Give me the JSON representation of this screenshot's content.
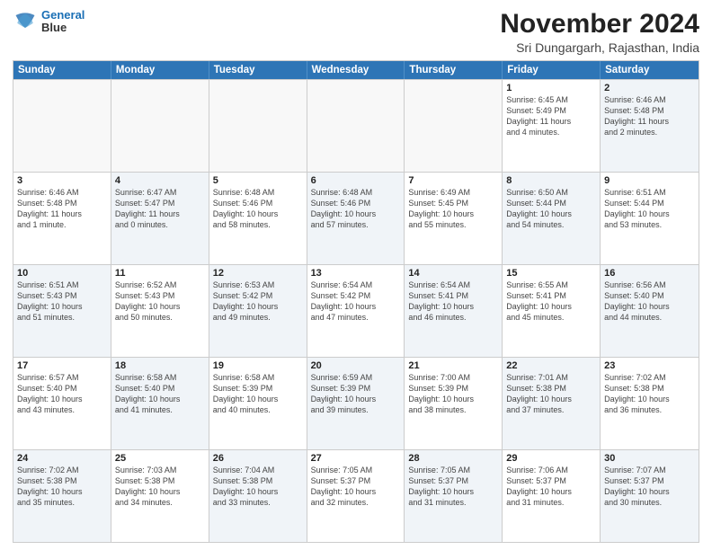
{
  "logo": {
    "line1": "General",
    "line2": "Blue"
  },
  "title": "November 2024",
  "subtitle": "Sri Dungargarh, Rajasthan, India",
  "header_days": [
    "Sunday",
    "Monday",
    "Tuesday",
    "Wednesday",
    "Thursday",
    "Friday",
    "Saturday"
  ],
  "weeks": [
    [
      {
        "day": "",
        "info": "",
        "empty": true
      },
      {
        "day": "",
        "info": "",
        "empty": true
      },
      {
        "day": "",
        "info": "",
        "empty": true
      },
      {
        "day": "",
        "info": "",
        "empty": true
      },
      {
        "day": "",
        "info": "",
        "empty": true
      },
      {
        "day": "1",
        "info": "Sunrise: 6:45 AM\nSunset: 5:49 PM\nDaylight: 11 hours\nand 4 minutes.",
        "empty": false
      },
      {
        "day": "2",
        "info": "Sunrise: 6:46 AM\nSunset: 5:48 PM\nDaylight: 11 hours\nand 2 minutes.",
        "empty": false,
        "shaded": true
      }
    ],
    [
      {
        "day": "3",
        "info": "Sunrise: 6:46 AM\nSunset: 5:48 PM\nDaylight: 11 hours\nand 1 minute.",
        "empty": false
      },
      {
        "day": "4",
        "info": "Sunrise: 6:47 AM\nSunset: 5:47 PM\nDaylight: 11 hours\nand 0 minutes.",
        "empty": false,
        "shaded": true
      },
      {
        "day": "5",
        "info": "Sunrise: 6:48 AM\nSunset: 5:46 PM\nDaylight: 10 hours\nand 58 minutes.",
        "empty": false
      },
      {
        "day": "6",
        "info": "Sunrise: 6:48 AM\nSunset: 5:46 PM\nDaylight: 10 hours\nand 57 minutes.",
        "empty": false,
        "shaded": true
      },
      {
        "day": "7",
        "info": "Sunrise: 6:49 AM\nSunset: 5:45 PM\nDaylight: 10 hours\nand 55 minutes.",
        "empty": false
      },
      {
        "day": "8",
        "info": "Sunrise: 6:50 AM\nSunset: 5:44 PM\nDaylight: 10 hours\nand 54 minutes.",
        "empty": false,
        "shaded": true
      },
      {
        "day": "9",
        "info": "Sunrise: 6:51 AM\nSunset: 5:44 PM\nDaylight: 10 hours\nand 53 minutes.",
        "empty": false
      }
    ],
    [
      {
        "day": "10",
        "info": "Sunrise: 6:51 AM\nSunset: 5:43 PM\nDaylight: 10 hours\nand 51 minutes.",
        "empty": false,
        "shaded": true
      },
      {
        "day": "11",
        "info": "Sunrise: 6:52 AM\nSunset: 5:43 PM\nDaylight: 10 hours\nand 50 minutes.",
        "empty": false
      },
      {
        "day": "12",
        "info": "Sunrise: 6:53 AM\nSunset: 5:42 PM\nDaylight: 10 hours\nand 49 minutes.",
        "empty": false,
        "shaded": true
      },
      {
        "day": "13",
        "info": "Sunrise: 6:54 AM\nSunset: 5:42 PM\nDaylight: 10 hours\nand 47 minutes.",
        "empty": false
      },
      {
        "day": "14",
        "info": "Sunrise: 6:54 AM\nSunset: 5:41 PM\nDaylight: 10 hours\nand 46 minutes.",
        "empty": false,
        "shaded": true
      },
      {
        "day": "15",
        "info": "Sunrise: 6:55 AM\nSunset: 5:41 PM\nDaylight: 10 hours\nand 45 minutes.",
        "empty": false
      },
      {
        "day": "16",
        "info": "Sunrise: 6:56 AM\nSunset: 5:40 PM\nDaylight: 10 hours\nand 44 minutes.",
        "empty": false,
        "shaded": true
      }
    ],
    [
      {
        "day": "17",
        "info": "Sunrise: 6:57 AM\nSunset: 5:40 PM\nDaylight: 10 hours\nand 43 minutes.",
        "empty": false
      },
      {
        "day": "18",
        "info": "Sunrise: 6:58 AM\nSunset: 5:40 PM\nDaylight: 10 hours\nand 41 minutes.",
        "empty": false,
        "shaded": true
      },
      {
        "day": "19",
        "info": "Sunrise: 6:58 AM\nSunset: 5:39 PM\nDaylight: 10 hours\nand 40 minutes.",
        "empty": false
      },
      {
        "day": "20",
        "info": "Sunrise: 6:59 AM\nSunset: 5:39 PM\nDaylight: 10 hours\nand 39 minutes.",
        "empty": false,
        "shaded": true
      },
      {
        "day": "21",
        "info": "Sunrise: 7:00 AM\nSunset: 5:39 PM\nDaylight: 10 hours\nand 38 minutes.",
        "empty": false
      },
      {
        "day": "22",
        "info": "Sunrise: 7:01 AM\nSunset: 5:38 PM\nDaylight: 10 hours\nand 37 minutes.",
        "empty": false,
        "shaded": true
      },
      {
        "day": "23",
        "info": "Sunrise: 7:02 AM\nSunset: 5:38 PM\nDaylight: 10 hours\nand 36 minutes.",
        "empty": false
      }
    ],
    [
      {
        "day": "24",
        "info": "Sunrise: 7:02 AM\nSunset: 5:38 PM\nDaylight: 10 hours\nand 35 minutes.",
        "empty": false,
        "shaded": true
      },
      {
        "day": "25",
        "info": "Sunrise: 7:03 AM\nSunset: 5:38 PM\nDaylight: 10 hours\nand 34 minutes.",
        "empty": false
      },
      {
        "day": "26",
        "info": "Sunrise: 7:04 AM\nSunset: 5:38 PM\nDaylight: 10 hours\nand 33 minutes.",
        "empty": false,
        "shaded": true
      },
      {
        "day": "27",
        "info": "Sunrise: 7:05 AM\nSunset: 5:37 PM\nDaylight: 10 hours\nand 32 minutes.",
        "empty": false
      },
      {
        "day": "28",
        "info": "Sunrise: 7:05 AM\nSunset: 5:37 PM\nDaylight: 10 hours\nand 31 minutes.",
        "empty": false,
        "shaded": true
      },
      {
        "day": "29",
        "info": "Sunrise: 7:06 AM\nSunset: 5:37 PM\nDaylight: 10 hours\nand 31 minutes.",
        "empty": false
      },
      {
        "day": "30",
        "info": "Sunrise: 7:07 AM\nSunset: 5:37 PM\nDaylight: 10 hours\nand 30 minutes.",
        "empty": false,
        "shaded": true
      }
    ]
  ]
}
